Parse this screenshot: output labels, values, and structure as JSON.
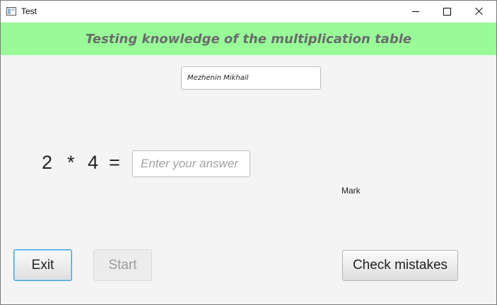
{
  "window": {
    "title": "Test",
    "controls": {
      "minimize": "minimize-icon",
      "maximize": "maximize-icon",
      "close": "close-icon"
    }
  },
  "header": {
    "banner_text": "Testing knowledge of the multiplication table",
    "banner_color": "#98fb98"
  },
  "form": {
    "name_value": "Mezhenin Mikhail"
  },
  "question": {
    "operand_a": "2",
    "operator": "*",
    "operand_b": "4",
    "equals": "=",
    "answer_placeholder": "Enter your answer",
    "answer_value": ""
  },
  "result": {
    "mark_label": "Mark"
  },
  "buttons": {
    "exit": "Exit",
    "start": "Start",
    "check_mistakes": "Check mistakes"
  }
}
